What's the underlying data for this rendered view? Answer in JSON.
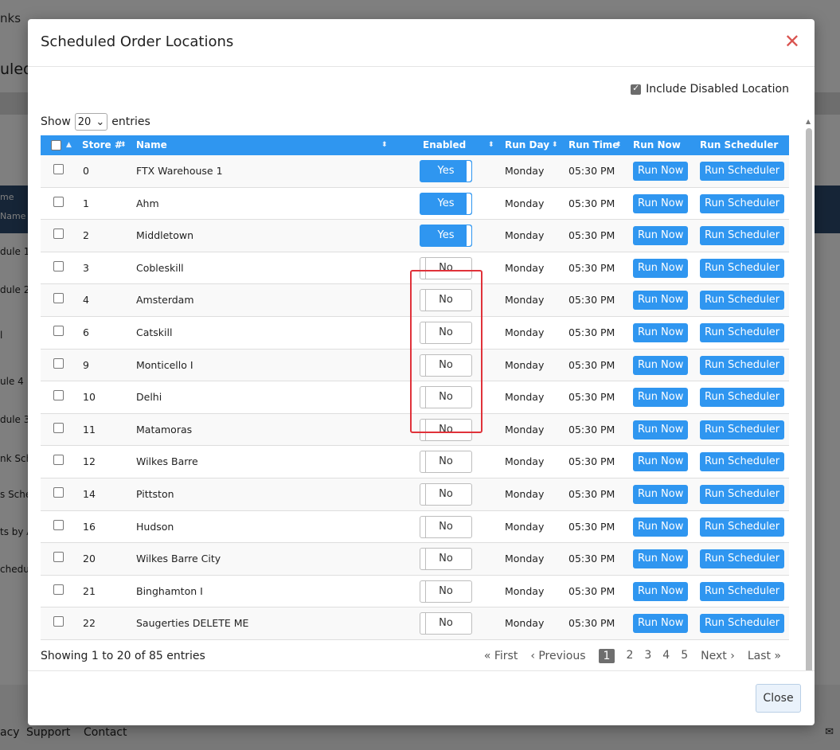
{
  "background": {
    "topbar_fragment": "nks",
    "title_fragment": "uled",
    "dark_header_labels": [
      "me",
      "Name"
    ],
    "row_fragments": [
      "dule 1",
      "dule 2",
      "l",
      "ule 4",
      "dule 3",
      "nk Sch",
      "s Sche",
      "ts by A",
      "chedul"
    ],
    "footer_links": [
      "acy",
      "Support",
      "Contact"
    ]
  },
  "modal": {
    "title": "Scheduled Order Locations",
    "include_disabled_label": "Include Disabled Location",
    "include_disabled_checked": true,
    "show_label": "Show",
    "entries_label": "entries",
    "page_size": "20",
    "columns": [
      "Store #",
      "Name",
      "Enabled",
      "Run Day",
      "Run Time",
      "Run Now",
      "Run Scheduler"
    ],
    "rows": [
      {
        "store": "0",
        "name": "FTX Warehouse 1",
        "enabled": "Yes",
        "run_day": "Monday",
        "run_time": "05:30 PM",
        "run_now": "Run Now",
        "run_scheduler": "Run Scheduler"
      },
      {
        "store": "1",
        "name": "Ahm",
        "enabled": "Yes",
        "run_day": "Monday",
        "run_time": "05:30 PM",
        "run_now": "Run Now",
        "run_scheduler": "Run Scheduler"
      },
      {
        "store": "2",
        "name": "Middletown",
        "enabled": "Yes",
        "run_day": "Monday",
        "run_time": "05:30 PM",
        "run_now": "Run Now",
        "run_scheduler": "Run Scheduler"
      },
      {
        "store": "3",
        "name": "Cobleskill",
        "enabled": "No",
        "run_day": "Monday",
        "run_time": "05:30 PM",
        "run_now": "Run Now",
        "run_scheduler": "Run Scheduler"
      },
      {
        "store": "4",
        "name": "Amsterdam",
        "enabled": "No",
        "run_day": "Monday",
        "run_time": "05:30 PM",
        "run_now": "Run Now",
        "run_scheduler": "Run Scheduler"
      },
      {
        "store": "6",
        "name": "Catskill",
        "enabled": "No",
        "run_day": "Monday",
        "run_time": "05:30 PM",
        "run_now": "Run Now",
        "run_scheduler": "Run Scheduler"
      },
      {
        "store": "9",
        "name": "Monticello I",
        "enabled": "No",
        "run_day": "Monday",
        "run_time": "05:30 PM",
        "run_now": "Run Now",
        "run_scheduler": "Run Scheduler"
      },
      {
        "store": "10",
        "name": "Delhi",
        "enabled": "No",
        "run_day": "Monday",
        "run_time": "05:30 PM",
        "run_now": "Run Now",
        "run_scheduler": "Run Scheduler"
      },
      {
        "store": "11",
        "name": "Matamoras",
        "enabled": "No",
        "run_day": "Monday",
        "run_time": "05:30 PM",
        "run_now": "Run Now",
        "run_scheduler": "Run Scheduler"
      },
      {
        "store": "12",
        "name": "Wilkes Barre",
        "enabled": "No",
        "run_day": "Monday",
        "run_time": "05:30 PM",
        "run_now": "Run Now",
        "run_scheduler": "Run Scheduler"
      },
      {
        "store": "14",
        "name": "Pittston",
        "enabled": "No",
        "run_day": "Monday",
        "run_time": "05:30 PM",
        "run_now": "Run Now",
        "run_scheduler": "Run Scheduler"
      },
      {
        "store": "16",
        "name": "Hudson",
        "enabled": "No",
        "run_day": "Monday",
        "run_time": "05:30 PM",
        "run_now": "Run Now",
        "run_scheduler": "Run Scheduler"
      },
      {
        "store": "20",
        "name": "Wilkes Barre City",
        "enabled": "No",
        "run_day": "Monday",
        "run_time": "05:30 PM",
        "run_now": "Run Now",
        "run_scheduler": "Run Scheduler"
      },
      {
        "store": "21",
        "name": "Binghamton I",
        "enabled": "No",
        "run_day": "Monday",
        "run_time": "05:30 PM",
        "run_now": "Run Now",
        "run_scheduler": "Run Scheduler"
      },
      {
        "store": "22",
        "name": "Saugerties DELETE ME",
        "enabled": "No",
        "run_day": "Monday",
        "run_time": "05:30 PM",
        "run_now": "Run Now",
        "run_scheduler": "Run Scheduler"
      }
    ],
    "info_text": "Showing 1 to 20 of 85 entries",
    "pagination": {
      "first": "« First",
      "previous": "‹ Previous",
      "pages": [
        "1",
        "2",
        "3",
        "4",
        "5"
      ],
      "current_page": "1",
      "next": "Next ›",
      "last": "Last »"
    },
    "close_button": "Close",
    "close_icon_glyph": "✕"
  },
  "colors": {
    "accent": "#2f96f0",
    "highlight": "#e0323a",
    "close_icon": "#d9534f"
  }
}
